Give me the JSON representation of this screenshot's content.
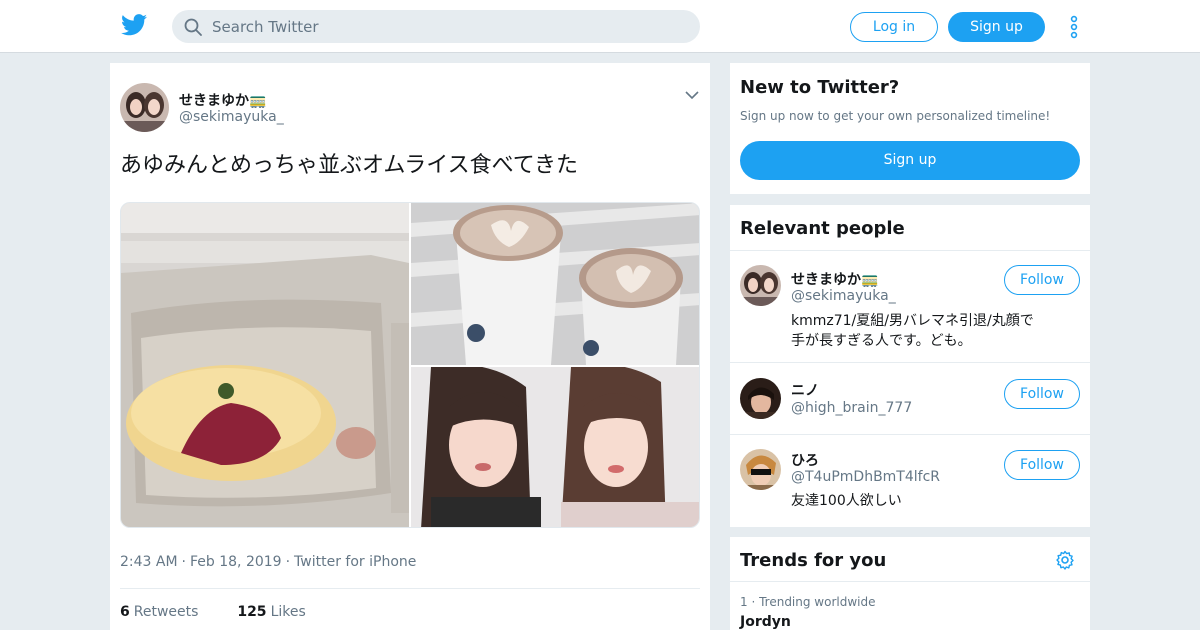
{
  "header": {
    "search_placeholder": "Search Twitter",
    "login_label": "Log in",
    "signup_label": "Sign up",
    "brand_color": "#1da1f2"
  },
  "tweet": {
    "author_name": "せきまゆか🚃",
    "author_handle": "@sekimayuka_",
    "text": "あゆみんとめっちゃ並ぶオムライス食べてきた",
    "time": "2:43 AM",
    "date": "Feb 18, 2019",
    "source": "Twitter for iPhone",
    "retweets_count": "6",
    "retweets_label": "Retweets",
    "likes_count": "125",
    "likes_label": "Likes"
  },
  "sidebar": {
    "new_to_twitter": {
      "title": "New to Twitter?",
      "subtitle": "Sign up now to get your own personalized timeline!",
      "button_label": "Sign up"
    },
    "relevant_people": {
      "title": "Relevant people",
      "people": [
        {
          "name": "せきまゆか🚃",
          "handle": "@sekimayuka_",
          "bio": "kmmz71/夏組/男バレマネ引退/丸顔で手が長すぎる人です。ども。",
          "follow_label": "Follow"
        },
        {
          "name": "ニノ",
          "handle": "@high_brain_777",
          "bio": "",
          "follow_label": "Follow"
        },
        {
          "name": "ひろ",
          "handle": "@T4uPmDhBmT4lfcR",
          "bio": "友達100人欲しい",
          "follow_label": "Follow"
        }
      ]
    },
    "trends": {
      "title": "Trends for you",
      "items": [
        {
          "rank": "1",
          "context": "Trending worldwide",
          "name": "Jordyn"
        }
      ]
    }
  }
}
